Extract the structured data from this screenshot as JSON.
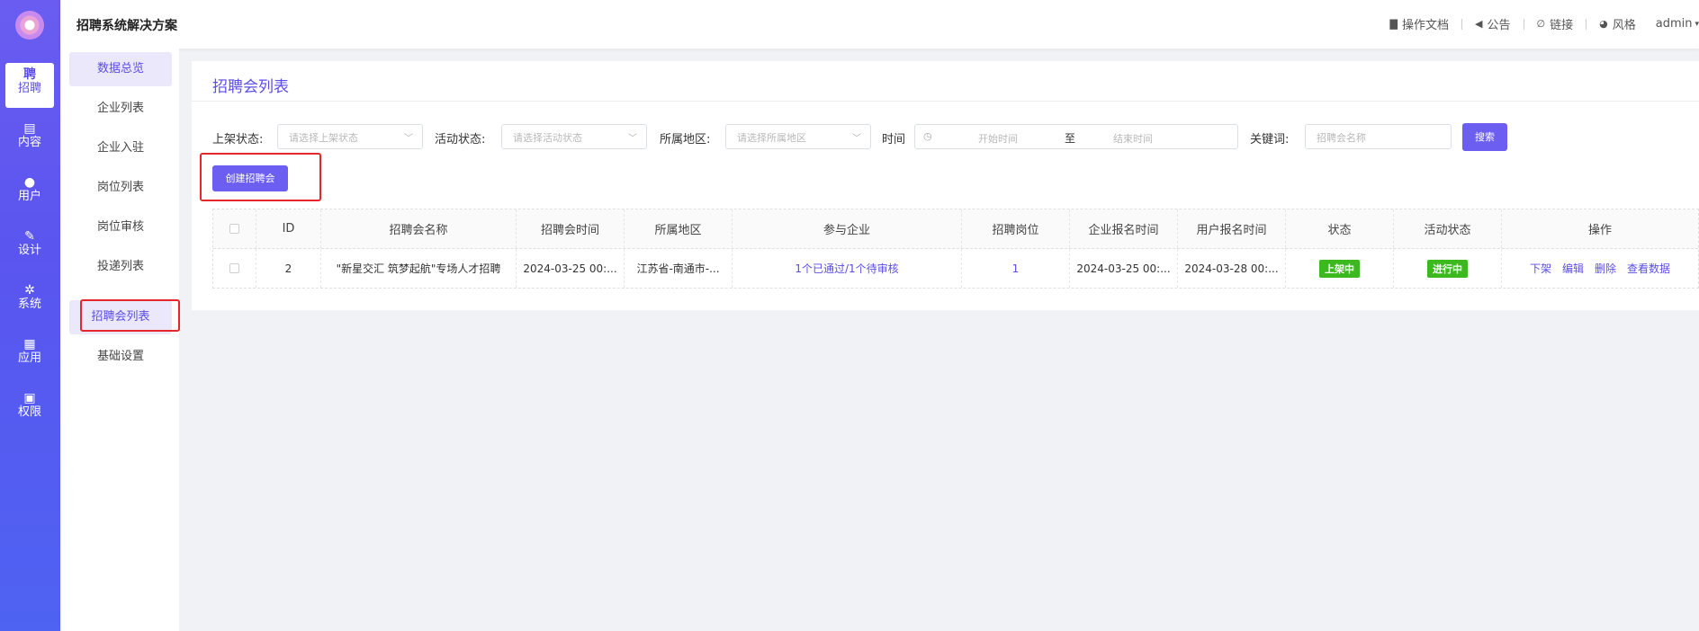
{
  "header": {
    "brand": "招聘系统解决方案",
    "links": [
      {
        "icon": "document-icon",
        "label": "操作文档"
      },
      {
        "icon": "announcement-icon",
        "label": "公告"
      },
      {
        "icon": "link-icon",
        "label": "链接"
      },
      {
        "icon": "palette-icon",
        "label": "风格"
      }
    ],
    "user": "admin"
  },
  "rail": {
    "items": [
      {
        "icon": "聘",
        "label": "招聘",
        "active": true
      },
      {
        "icon": "▤",
        "label": "内容"
      },
      {
        "icon": "●",
        "label": "用户"
      },
      {
        "icon": "✎",
        "label": "设计"
      },
      {
        "icon": "✲",
        "label": "系统"
      },
      {
        "icon": "▦",
        "label": "应用"
      },
      {
        "icon": "▣",
        "label": "权限"
      }
    ]
  },
  "submenu": {
    "items": [
      "数据总览",
      "企业列表",
      "企业入驻",
      "岗位列表",
      "岗位审核",
      "投递列表",
      "招聘会列表",
      "基础设置"
    ]
  },
  "page": {
    "title": "招聘会列表"
  },
  "filters": {
    "shelf_label": "上架状态:",
    "shelf_placeholder": "请选择上架状态",
    "activity_label": "活动状态:",
    "activity_placeholder": "请选择活动状态",
    "region_label": "所属地区:",
    "region_placeholder": "请选择所属地区",
    "time_label": "时间",
    "start_placeholder": "开始时间",
    "range_sep": "至",
    "end_placeholder": "结束时间",
    "keyword_label": "关键词:",
    "keyword_placeholder": "招聘会名称",
    "search_label": "搜索"
  },
  "create_button": "创建招聘会",
  "table": {
    "headers": [
      "ID",
      "招聘会名称",
      "招聘会时间",
      "所属地区",
      "参与企业",
      "招聘岗位",
      "企业报名时间",
      "用户报名时间",
      "状态",
      "活动状态",
      "操作"
    ],
    "rows": [
      {
        "id": "2",
        "name": "\"新星交汇 筑梦起航\"专场人才招聘",
        "time": "2024-03-25 00:...",
        "region": "江苏省-南通市-...",
        "companies": "1个已通过/1个待审核",
        "positions": "1",
        "company_signup": "2024-03-25 00:...",
        "user_signup": "2024-03-28 00:...",
        "status": "上架中",
        "activity_status": "进行中",
        "actions": [
          "下架",
          "编辑",
          "删除",
          "查看数据"
        ]
      }
    ]
  },
  "colors": {
    "accent": "#6b5ef0",
    "rail_top": "#6a5cf0",
    "tag_green": "#3cb91f",
    "highlight_red": "#e5262a"
  }
}
